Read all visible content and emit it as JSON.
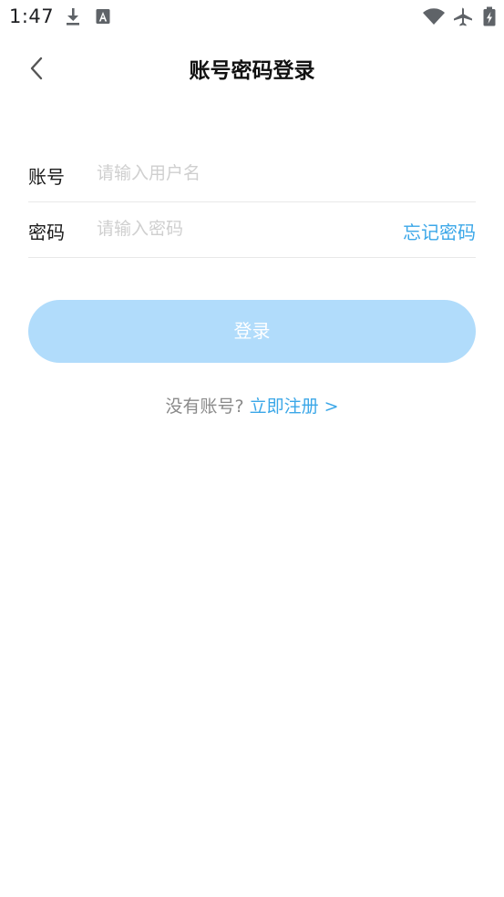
{
  "status_bar": {
    "time": "1:47",
    "icons": [
      "download-icon",
      "a-text-icon",
      "wifi-icon",
      "airplane-mode-icon",
      "battery-charging-icon"
    ]
  },
  "header": {
    "title": "账号密码登录",
    "back_icon": "chevron-left-icon"
  },
  "form": {
    "account": {
      "label": "账号",
      "placeholder": "请输入用户名",
      "value": ""
    },
    "password": {
      "label": "密码",
      "placeholder": "请输入密码",
      "value": "",
      "forgot_label": "忘记密码"
    }
  },
  "login_button": {
    "label": "登录"
  },
  "register": {
    "hint": "没有账号?",
    "link_label": "立即注册 >"
  },
  "colors": {
    "accent": "#3ba7e8",
    "button_disabled": "#b1dcfb",
    "divider": "#e8e8e8",
    "placeholder": "#cfcfcf"
  }
}
